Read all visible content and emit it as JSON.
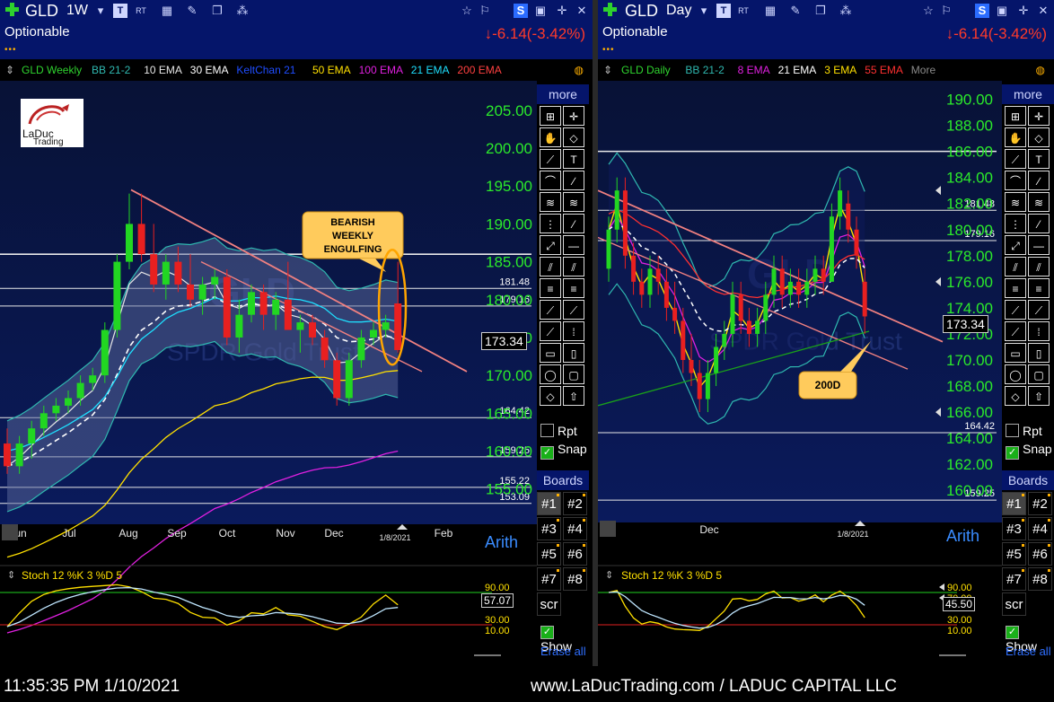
{
  "left": {
    "symbol": "GLD",
    "interval": "1W",
    "subtitle": "Optionable",
    "change": "↓-6.14(-3.42%)",
    "legend": [
      {
        "text": "GLD Weekly",
        "color": "#2fd42f"
      },
      {
        "text": "BB 21-2",
        "color": "#2fb8b0"
      },
      {
        "text": "10 EMA",
        "color": "#e6e6e6"
      },
      {
        "text": "30 EMA",
        "color": "#ffffff"
      },
      {
        "text": "KeltChan 21",
        "color": "#1f4dff"
      },
      {
        "text": "50 EMA",
        "color": "#ffe000"
      },
      {
        "text": "100 EMA",
        "color": "#e020e0"
      },
      {
        "text": "21 EMA",
        "color": "#1ee0ff"
      },
      {
        "text": "200 EMA",
        "color": "#ff4040"
      }
    ],
    "logo_text": [
      "LaDuc",
      "Trading"
    ],
    "watermark": [
      "GLD",
      "SPDR Gold Trust"
    ],
    "price_label": "173.34",
    "date_label": "1/8/2021",
    "axis_label": "Arith",
    "callout": [
      "BEARISH",
      "WEEKLY",
      "ENGULFING"
    ],
    "stoch_label": "Stoch 12 %K 3 %D 5",
    "stoch_value": "57.07",
    "tools_more": "more",
    "rpt": "Rpt",
    "snap": "Snap",
    "boards": "Boards",
    "board_items": [
      "#1",
      "#2",
      "#3",
      "#4",
      "#5",
      "#6",
      "#7",
      "#8",
      "scr"
    ],
    "show": "Show",
    "erase": "Erase all"
  },
  "right": {
    "symbol": "GLD",
    "interval": "Day",
    "subtitle": "Optionable",
    "change": "↓-6.14(-3.42%)",
    "legend": [
      {
        "text": "GLD Daily",
        "color": "#2fd42f"
      },
      {
        "text": "BB 21-2",
        "color": "#2fb8b0"
      },
      {
        "text": "8 EMA",
        "color": "#e020e0"
      },
      {
        "text": "21 EMA",
        "color": "#ffffff"
      },
      {
        "text": "3 EMA",
        "color": "#ffe000"
      },
      {
        "text": "55 EMA",
        "color": "#ff3030"
      },
      {
        "text": "More",
        "color": "#8a8a8a"
      }
    ],
    "watermark": [
      "GLD",
      "SPDR Gold Trust"
    ],
    "price_label": "173.34",
    "date_label": "1/8/2021",
    "axis_label": "Arith",
    "callout": [
      "200D"
    ],
    "stoch_label": "Stoch 12 %K 3 %D 5",
    "stoch_value": "45.50",
    "tools_more": "more",
    "rpt": "Rpt",
    "snap": "Snap",
    "boards": "Boards",
    "board_items": [
      "#1",
      "#2",
      "#3",
      "#4",
      "#5",
      "#6",
      "#7",
      "#8",
      "scr"
    ],
    "show": "Show",
    "erase": "Erase all"
  },
  "footer": {
    "time": "11:35:35 PM 1/10/2021",
    "website": "www.LaDucTrading.com / LADUC CAPITAL LLC"
  },
  "chart_data": [
    {
      "type": "candlestick",
      "title": "GLD Weekly",
      "ylim": [
        152,
        207
      ],
      "yticks": [
        155,
        160,
        165,
        170,
        175,
        180,
        185,
        190,
        195,
        200,
        205
      ],
      "x_tick_labels": [
        "Jun",
        "Jul",
        "Aug",
        "Sep",
        "Oct",
        "Nov",
        "Dec",
        "Feb"
      ],
      "horizontal_levels": [
        186,
        181.48,
        179.16,
        164.42,
        159.25,
        155.22,
        153.09
      ],
      "level_labels": [
        "181.48",
        "179.16",
        "164.42",
        "159.25",
        "155.22",
        "153.09"
      ],
      "last_price": 173.34,
      "candles": [
        {
          "o": 161,
          "h": 163,
          "l": 157,
          "c": 158
        },
        {
          "o": 158,
          "h": 162,
          "l": 157,
          "c": 161
        },
        {
          "o": 161,
          "h": 164,
          "l": 159,
          "c": 163
        },
        {
          "o": 163,
          "h": 166,
          "l": 162,
          "c": 165
        },
        {
          "o": 165,
          "h": 167,
          "l": 164,
          "c": 166
        },
        {
          "o": 166,
          "h": 168,
          "l": 165,
          "c": 167
        },
        {
          "o": 167,
          "h": 170,
          "l": 166,
          "c": 169
        },
        {
          "o": 169,
          "h": 171,
          "l": 168,
          "c": 170
        },
        {
          "o": 170,
          "h": 177,
          "l": 169,
          "c": 176
        },
        {
          "o": 176,
          "h": 186,
          "l": 175,
          "c": 185
        },
        {
          "o": 185,
          "h": 194,
          "l": 184,
          "c": 190
        },
        {
          "o": 190,
          "h": 194,
          "l": 185,
          "c": 186
        },
        {
          "o": 186,
          "h": 190,
          "l": 181,
          "c": 182
        },
        {
          "o": 182,
          "h": 186,
          "l": 180,
          "c": 185
        },
        {
          "o": 185,
          "h": 187,
          "l": 181,
          "c": 182
        },
        {
          "o": 182,
          "h": 186,
          "l": 179,
          "c": 180
        },
        {
          "o": 180,
          "h": 183,
          "l": 178,
          "c": 182
        },
        {
          "o": 182,
          "h": 184,
          "l": 180,
          "c": 183
        },
        {
          "o": 183,
          "h": 184,
          "l": 174,
          "c": 175
        },
        {
          "o": 175,
          "h": 180,
          "l": 173,
          "c": 178
        },
        {
          "o": 178,
          "h": 182,
          "l": 177,
          "c": 181
        },
        {
          "o": 181,
          "h": 182,
          "l": 176,
          "c": 178
        },
        {
          "o": 178,
          "h": 181,
          "l": 176,
          "c": 180
        },
        {
          "o": 180,
          "h": 185,
          "l": 177,
          "c": 176
        },
        {
          "o": 176,
          "h": 178,
          "l": 173,
          "c": 177
        },
        {
          "o": 177,
          "h": 178,
          "l": 174,
          "c": 175
        },
        {
          "o": 175,
          "h": 176,
          "l": 171,
          "c": 172
        },
        {
          "o": 172,
          "h": 173,
          "l": 166,
          "c": 167
        },
        {
          "o": 167,
          "h": 173,
          "l": 166,
          "c": 172
        },
        {
          "o": 172,
          "h": 176,
          "l": 171,
          "c": 175
        },
        {
          "o": 175,
          "h": 177,
          "l": 174,
          "c": 176
        },
        {
          "o": 176,
          "h": 178,
          "l": 175,
          "c": 177
        },
        {
          "o": 179.5,
          "h": 185,
          "l": 173,
          "c": 173.34
        }
      ]
    },
    {
      "type": "candlestick",
      "title": "GLD Daily",
      "ylim": [
        158.5,
        191
      ],
      "yticks": [
        160,
        162,
        164,
        166,
        168,
        170,
        172,
        174,
        176,
        178,
        180,
        182,
        184,
        186,
        188,
        190
      ],
      "x_tick_labels": [
        "Dec"
      ],
      "horizontal_levels": [
        186,
        181.48,
        179.16,
        164.42,
        159.25
      ],
      "level_labels": [
        "181.48",
        "179.16",
        "164.42",
        "159.25"
      ],
      "last_price": 173.34,
      "candles": [
        {
          "o": 177,
          "h": 181,
          "l": 176,
          "c": 180
        },
        {
          "o": 180,
          "h": 184,
          "l": 179,
          "c": 183
        },
        {
          "o": 183,
          "h": 184,
          "l": 177,
          "c": 178
        },
        {
          "o": 178,
          "h": 179,
          "l": 175,
          "c": 176
        },
        {
          "o": 176,
          "h": 177,
          "l": 174,
          "c": 175
        },
        {
          "o": 175,
          "h": 178,
          "l": 174,
          "c": 177
        },
        {
          "o": 177,
          "h": 178,
          "l": 175,
          "c": 176
        },
        {
          "o": 176,
          "h": 177,
          "l": 173,
          "c": 174
        },
        {
          "o": 174,
          "h": 176,
          "l": 172,
          "c": 173
        },
        {
          "o": 173,
          "h": 174,
          "l": 169,
          "c": 170
        },
        {
          "o": 170,
          "h": 172,
          "l": 168,
          "c": 169
        },
        {
          "o": 169,
          "h": 170,
          "l": 166,
          "c": 167
        },
        {
          "o": 167,
          "h": 170,
          "l": 166,
          "c": 169
        },
        {
          "o": 169,
          "h": 172,
          "l": 168,
          "c": 171
        },
        {
          "o": 171,
          "h": 173,
          "l": 170,
          "c": 172
        },
        {
          "o": 172,
          "h": 176,
          "l": 171,
          "c": 175
        },
        {
          "o": 175,
          "h": 176,
          "l": 172,
          "c": 173
        },
        {
          "o": 173,
          "h": 174,
          "l": 171,
          "c": 172
        },
        {
          "o": 172,
          "h": 174,
          "l": 171,
          "c": 173
        },
        {
          "o": 173,
          "h": 176,
          "l": 172,
          "c": 175
        },
        {
          "o": 175,
          "h": 178,
          "l": 174,
          "c": 177
        },
        {
          "o": 177,
          "h": 178,
          "l": 174,
          "c": 175
        },
        {
          "o": 175,
          "h": 177,
          "l": 174,
          "c": 176
        },
        {
          "o": 176,
          "h": 177,
          "l": 174,
          "c": 175
        },
        {
          "o": 175,
          "h": 177,
          "l": 174,
          "c": 176
        },
        {
          "o": 176,
          "h": 178,
          "l": 175,
          "c": 177
        },
        {
          "o": 177,
          "h": 178,
          "l": 175,
          "c": 176
        },
        {
          "o": 176,
          "h": 182,
          "l": 176,
          "c": 181
        },
        {
          "o": 181,
          "h": 184,
          "l": 180,
          "c": 183
        },
        {
          "o": 182,
          "h": 183,
          "l": 179,
          "c": 180
        },
        {
          "o": 180,
          "h": 181,
          "l": 177,
          "c": 178
        },
        {
          "o": 176,
          "h": 177,
          "l": 172,
          "c": 173.34
        }
      ]
    }
  ]
}
